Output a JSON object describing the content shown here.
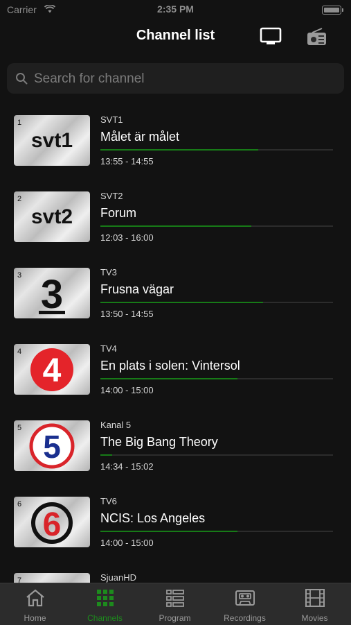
{
  "status": {
    "carrier": "Carrier",
    "time": "2:35 PM"
  },
  "header": {
    "title": "Channel list",
    "tv_icon": "tv-icon",
    "radio_icon": "radio-icon"
  },
  "search": {
    "placeholder": "Search for channel",
    "value": ""
  },
  "colors": {
    "accent": "#177a17",
    "tab_active": "#1d8b1d",
    "background": "#121212"
  },
  "channels": [
    {
      "number": "1",
      "channel": "SVT1",
      "program": "Målet är målet",
      "time": "13:55 - 14:55",
      "progress": 0.68
    },
    {
      "number": "2",
      "channel": "SVT2",
      "program": "Forum",
      "time": "12:03 - 16:00",
      "progress": 0.65
    },
    {
      "number": "3",
      "channel": "TV3",
      "program": "Frusna vägar",
      "time": "13:50 - 14:55",
      "progress": 0.7
    },
    {
      "number": "4",
      "channel": "TV4",
      "program": "En plats i solen: Vintersol",
      "time": "14:00 - 15:00",
      "progress": 0.59
    },
    {
      "number": "5",
      "channel": "Kanal 5",
      "program": "The Big Bang Theory",
      "time": "14:34 - 15:02",
      "progress": 0.05
    },
    {
      "number": "6",
      "channel": "TV6",
      "program": "NCIS: Los Angeles",
      "time": "14:00 - 15:00",
      "progress": 0.59
    },
    {
      "number": "7",
      "channel": "SjuanHD",
      "program": "",
      "time": "",
      "progress": 0
    }
  ],
  "logos": {
    "svt1": "svt1",
    "svt2": "svt2",
    "tv3": "3",
    "tv4": "4",
    "kanal5": "5",
    "tv6": "6"
  },
  "tabs": [
    {
      "label": "Home",
      "icon": "home-icon",
      "active": false
    },
    {
      "label": "Channels",
      "icon": "grid-icon",
      "active": true
    },
    {
      "label": "Program",
      "icon": "list-icon",
      "active": false
    },
    {
      "label": "Recordings",
      "icon": "cassette-icon",
      "active": false
    },
    {
      "label": "Movies",
      "icon": "film-icon",
      "active": false
    }
  ]
}
